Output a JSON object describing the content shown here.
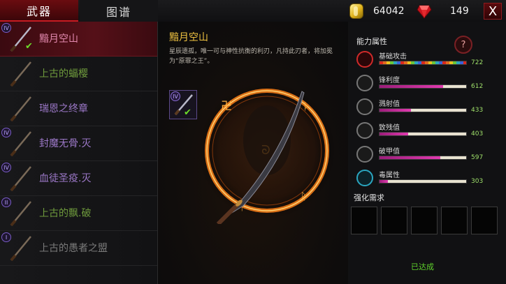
{
  "tabs": [
    {
      "label": "武器",
      "active": true
    },
    {
      "label": "图谱",
      "active": false
    }
  ],
  "currency": {
    "gold": {
      "icon": "gold-coin-icon",
      "value": "64042"
    },
    "gems": {
      "icon": "ruby-gem-icon",
      "value": "149"
    }
  },
  "close_label": "X",
  "weapon_list": [
    {
      "name": "黯月空山",
      "tier": "IV",
      "selected": true,
      "equipped": true,
      "color": "#e48ab0"
    },
    {
      "name": "上古的蝠樱",
      "tier": "",
      "selected": false,
      "equipped": false,
      "color": "#6e9a3c"
    },
    {
      "name": "瑞恩之终章",
      "tier": "",
      "selected": false,
      "equipped": false,
      "color": "#9c78c8"
    },
    {
      "name": "封魔无骨.灭",
      "tier": "IV",
      "selected": false,
      "equipped": false,
      "color": "#9c78c8"
    },
    {
      "name": "血徒圣疫.灭",
      "tier": "IV",
      "selected": false,
      "equipped": false,
      "color": "#9c78c8"
    },
    {
      "name": "上古的飘.破",
      "tier": "II",
      "selected": false,
      "equipped": false,
      "color": "#6e9a3c"
    },
    {
      "name": "上古的愚者之盟",
      "tier": "I",
      "selected": false,
      "equipped": false,
      "color": "#7a7a7a"
    }
  ],
  "weapon": {
    "name": "黯月空山",
    "description": "星辰遗孤，唯一可与神性抗衡的利刃，凡持此刃者，将加冕为“原罪之王”。",
    "thumb_tier": "IV"
  },
  "attributes": {
    "section_label": "能力属性",
    "help_label": "?",
    "stats": [
      {
        "name": "基础攻击",
        "value": "722",
        "icon": "attack-icon",
        "fill": 1.0,
        "rainbow": true
      },
      {
        "name": "锋利度",
        "value": "612",
        "icon": "sharpness-icon",
        "fill": 0.73,
        "rainbow": false
      },
      {
        "name": "溅射值",
        "value": "433",
        "icon": "splash-icon",
        "fill": 0.36,
        "rainbow": false
      },
      {
        "name": "致残值",
        "value": "403",
        "icon": "cripple-icon",
        "fill": 0.33,
        "rainbow": false
      },
      {
        "name": "破甲值",
        "value": "597",
        "icon": "armor-break-icon",
        "fill": 0.7,
        "rainbow": false
      },
      {
        "name": "毒属性",
        "value": "303",
        "icon": "poison-skull-icon",
        "fill": 0.1,
        "rainbow": false
      }
    ]
  },
  "enhance": {
    "section_label": "强化需求",
    "status": "已达成"
  }
}
